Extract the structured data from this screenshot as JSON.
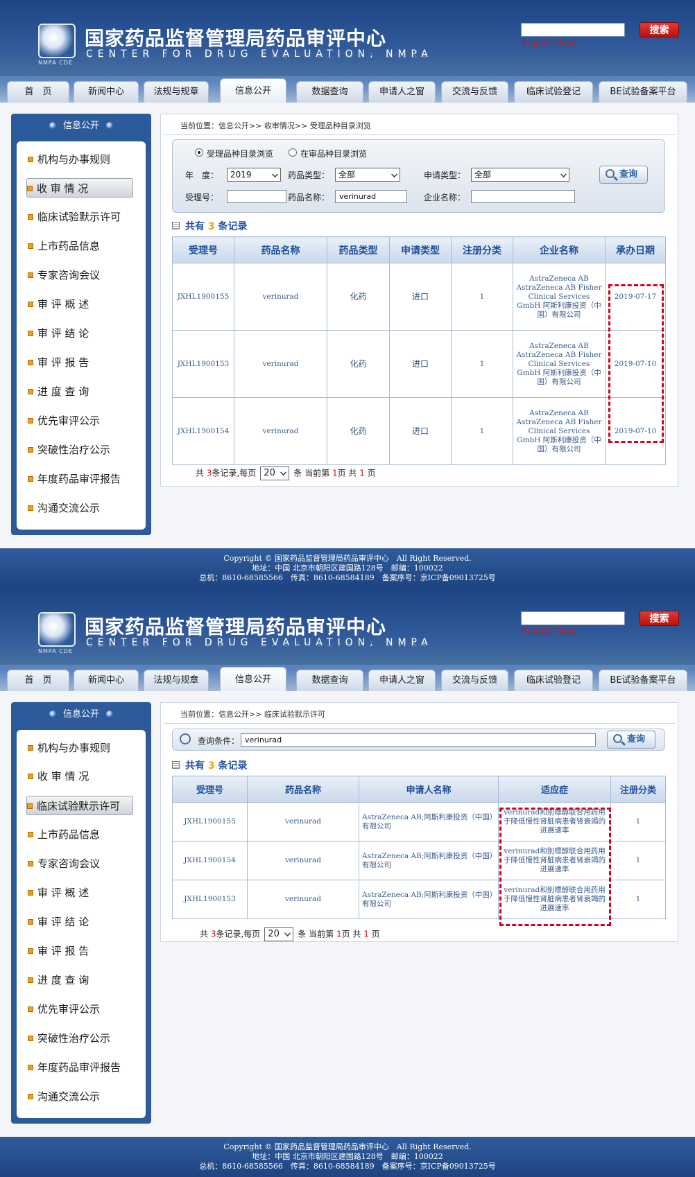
{
  "header": {
    "title": "国家药品监督管理局药品审评中心",
    "title_en": "CENTER FOR DRUG EVALUATION, NMPA",
    "logo_sub": "NMPA CDE",
    "search_button": "搜索",
    "english_link": "English Page"
  },
  "nav": [
    "首　页",
    "新闻中心",
    "法规与规章",
    "信息公开",
    "数据查询",
    "申请人之窗",
    "交流与反馈",
    "临床试验登记",
    "BE试验备案平台"
  ],
  "sidebar": {
    "heading": "信息公开",
    "items": [
      "机构与办事规则",
      "收 审 情 况",
      "临床试验默示许可",
      "上市药品信息",
      "专家咨询会议",
      "审 评 概 述",
      "审 评 结 论",
      "审 评 报 告",
      "进 度 查 询",
      "优先审评公示",
      "突破性治疗公示",
      "年度药品审评报告",
      "沟通交流公示"
    ]
  },
  "footer": {
    "line1": "Copyright © 国家药品监督管理局药品审评中心　All Right Reserved.",
    "line2": "地址：中国 北京市朝阳区建国路128号　邮编：100022",
    "line3": "总机：8610-68585566　传真：8610-68584189　备案序号：京ICP备09013725号"
  },
  "screen1": {
    "breadcrumb": "当前位置：信息公开>> 收审情况>> 受理品种目录浏览",
    "radio1": "受理品种目录浏览",
    "radio2": "在审品种目录浏览",
    "year_label": "年　度：",
    "year_value": "2019",
    "drug_type_label": "药品类型：",
    "drug_type_value": "全部",
    "apply_type_label": "申请类型：",
    "apply_type_value": "全部",
    "query_button": "查询",
    "accept_no_label": "受理号：",
    "accept_no_value": "",
    "drug_name_label": "药品名称：",
    "drug_name_value": "verinurad",
    "company_label": "企业名称：",
    "company_value": "",
    "total_prefix": "共有",
    "total_count": "3",
    "total_suffix": "条记录",
    "columns": [
      "受理号",
      "药品名称",
      "药品类型",
      "申请类型",
      "注册分类",
      "企业名称",
      "承办日期"
    ],
    "rows": [
      {
        "no": "JXHL1900155",
        "name": "verinurad",
        "type": "化药",
        "apply": "进口",
        "cls": "1",
        "company": "AstraZeneca AB AstraZeneca AB Fisher Clinical Services GmbH 阿斯利康投资（中国）有限公司",
        "date": "2019-07-17"
      },
      {
        "no": "JXHL1900153",
        "name": "verinurad",
        "type": "化药",
        "apply": "进口",
        "cls": "1",
        "company": "AstraZeneca AB AstraZeneca AB Fisher Clinical Services GmbH 阿斯利康投资（中国）有限公司",
        "date": "2019-07-10"
      },
      {
        "no": "JXHL1900154",
        "name": "verinurad",
        "type": "化药",
        "apply": "进口",
        "cls": "1",
        "company": "AstraZeneca AB AstraZeneca AB Fisher Clinical Services GmbH 阿斯利康投资（中国）有限公司",
        "date": "2019-07-10"
      }
    ],
    "pager": {
      "a": "共 ",
      "count": "3",
      "b": "条记录,每页",
      "per": "20",
      "c": "条 当前第 ",
      "cur": "1",
      "d": "页 共 ",
      "pages": "1",
      "e": " 页"
    }
  },
  "screen2": {
    "breadcrumb": "当前位置：信息公开>> 临床试验默示许可",
    "query_label": "查询条件：",
    "query_value": "verinurad",
    "query_button": "查询",
    "total_prefix": "共有",
    "total_count": "3",
    "total_suffix": "条记录",
    "columns": [
      "受理号",
      "药品名称",
      "申请人名称",
      "适应症",
      "注册分类"
    ],
    "rows": [
      {
        "no": "JXHL1900155",
        "name": "verinurad",
        "applicant": "AstraZeneca AB;阿斯利康投资（中国）有限公司",
        "indication": "verinurad和别嘌醇联合用药用于降低慢性肾脏病患者肾衰竭的进展速率",
        "cls": "1"
      },
      {
        "no": "JXHL1900154",
        "name": "verinurad",
        "applicant": "AstraZeneca AB;阿斯利康投资（中国）有限公司",
        "indication": "verinurad和别嘌醇联合用药用于降低慢性肾脏病患者肾衰竭的进展速率",
        "cls": "1"
      },
      {
        "no": "JXHL1900153",
        "name": "verinurad",
        "applicant": "AstraZeneca AB;阿斯利康投资（中国）有限公司",
        "indication": "verinurad和别嘌醇联合用药用于降低慢性肾脏病患者肾衰竭的进展速率",
        "cls": "1"
      }
    ],
    "pager": {
      "a": "共 ",
      "count": "3",
      "b": "条记录,每页",
      "per": "20",
      "c": "条 当前第 ",
      "cur": "1",
      "d": "页 共 ",
      "pages": "1",
      "e": " 页"
    }
  },
  "colors": {
    "accent": "#2d5a9a",
    "highlight": "#d0021b",
    "count": "#e8a21b"
  }
}
